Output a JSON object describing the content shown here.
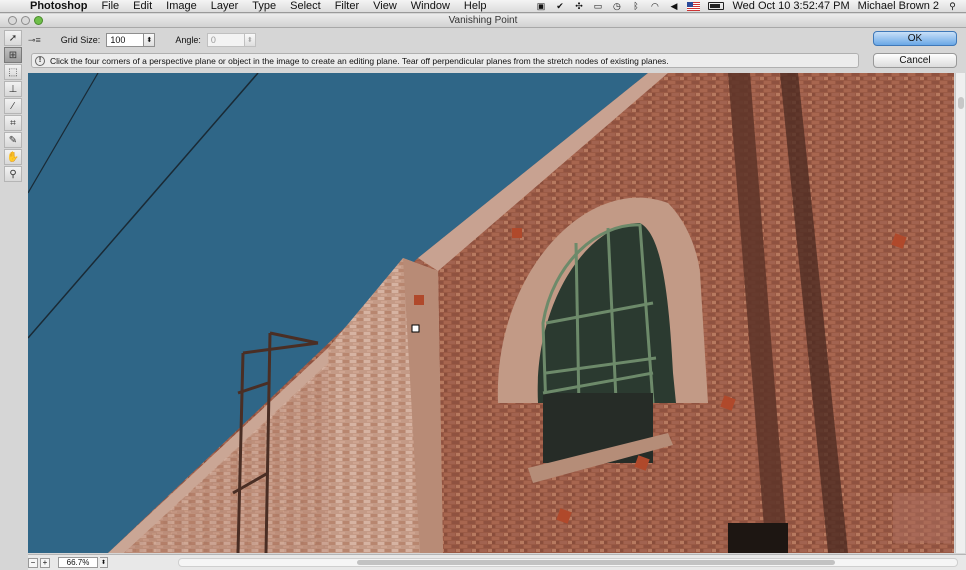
{
  "menubar": {
    "app_name": "Photoshop",
    "menus": [
      "File",
      "Edit",
      "Image",
      "Layer",
      "Type",
      "Select",
      "Filter",
      "View",
      "Window",
      "Help"
    ],
    "clock": "Wed Oct 10  3:52:47 PM",
    "user": "Michael Brown 2"
  },
  "window": {
    "title": "Vanishing Point"
  },
  "options": {
    "grid_size_label": "Grid Size:",
    "grid_size_value": "100",
    "angle_label": "Angle:",
    "angle_value": "0"
  },
  "info": {
    "message": "Click the four corners of a perspective plane or object in the image to create an editing plane. Tear off perpendicular planes from the stretch nodes of existing planes."
  },
  "buttons": {
    "ok": "OK",
    "cancel": "Cancel"
  },
  "status": {
    "zoom": "66.7%"
  },
  "tools": [
    "edit-plane-tool",
    "create-plane-tool",
    "marquee-tool",
    "stamp-tool",
    "brush-tool",
    "transform-tool",
    "eyedropper-tool",
    "hand-tool",
    "zoom-tool"
  ],
  "colors": {
    "sky": "#2f6687",
    "brick": "#9a5a45",
    "ok_button": "#6aa8e6"
  }
}
